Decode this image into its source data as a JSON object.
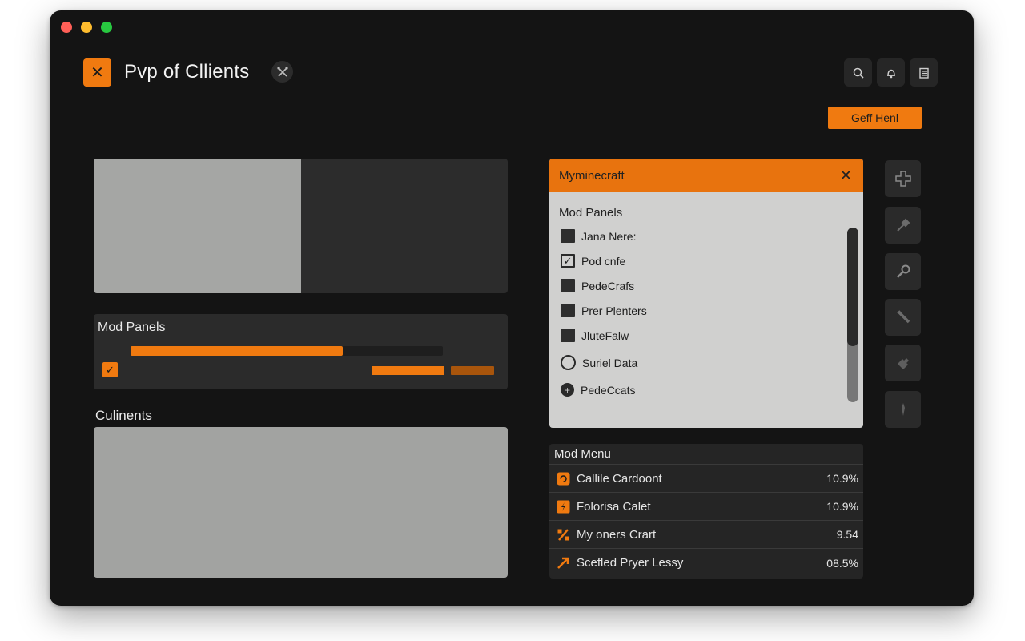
{
  "app": {
    "title": "Pvp of Cllients",
    "cta_label": "Geff Henl"
  },
  "colors": {
    "accent": "#f07a10",
    "window_bg": "#141414",
    "panel_bg": "#2b2b2b",
    "light_panel": "#d0d0cf"
  },
  "icons": {
    "logo": "close-x-icon",
    "title_action": "crossed-tools-icon",
    "top": [
      "search-icon",
      "bell-icon",
      "clipboard-icon"
    ],
    "side_tools": [
      "dpad-icon",
      "hammer-icon",
      "wrench-icon",
      "tool-icon",
      "puzzle-icon",
      "pin-icon"
    ]
  },
  "mod_panel": {
    "title": "Mod Panels",
    "progress": 0.68
  },
  "clients": {
    "label": "Culinents"
  },
  "minecraft_panel": {
    "title": "Myminecraft",
    "subtitle": "Mod Panels",
    "items": [
      {
        "label": "Jana Nere:",
        "control": "checkbox",
        "checked": false
      },
      {
        "label": "Pod cnfe",
        "control": "checkbox",
        "checked": true
      },
      {
        "label": "PedeCrafs",
        "control": "checkbox",
        "checked": false
      },
      {
        "label": "Prer Plenters",
        "control": "checkbox",
        "checked": false
      },
      {
        "label": "JluteFalw",
        "control": "checkbox",
        "checked": false
      },
      {
        "label": "Suriel Data",
        "control": "radio",
        "checked": false
      },
      {
        "label": "PedeCcats",
        "control": "radio-plus",
        "checked": false
      }
    ]
  },
  "mod_menu": {
    "title": "Mod Menu",
    "rows": [
      {
        "name": "Callile Cardoont",
        "value": "10.9%"
      },
      {
        "name": "Folorisa Calet",
        "value": "10.9%"
      },
      {
        "name": "My oners Crart",
        "value": "9.54"
      },
      {
        "name": "Scefled Pryer Lessy",
        "value": "08.5%"
      }
    ]
  }
}
